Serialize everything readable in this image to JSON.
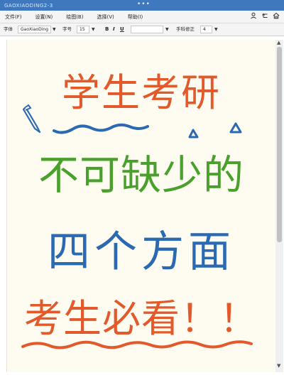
{
  "window": {
    "title": "GAOXIAODING2-3"
  },
  "menu": {
    "items": [
      "文件(F)",
      "设置(N)",
      "绘图(B)",
      "选择(V)",
      "帮助(I)"
    ]
  },
  "toolbar": {
    "font_label": "字体",
    "font_value": "GaoXiaoDing",
    "size_label": "字号",
    "size_value": "15",
    "bold": "B",
    "italic": "I",
    "underline": "U",
    "color_value": "",
    "handwriting_label": "手科修正",
    "handwriting_value": "4"
  },
  "canvas": {
    "lines": [
      {
        "text": "学生考研",
        "color": "#e25a2c"
      },
      {
        "text": "不可缺少的",
        "color": "#4aa02c"
      },
      {
        "text": "四个方面",
        "color": "#2b69b1"
      },
      {
        "text": "考生必看！！",
        "color": "#e25a2c"
      }
    ]
  },
  "colors": {
    "titlebar": "#3f78bd",
    "canvas_bg": "#fefcf1",
    "orange": "#e25a2c",
    "green": "#4aa02c",
    "blue": "#2b69b1"
  },
  "icons": [
    "user-icon",
    "undo-icon",
    "home-icon",
    "pencil-icon"
  ]
}
